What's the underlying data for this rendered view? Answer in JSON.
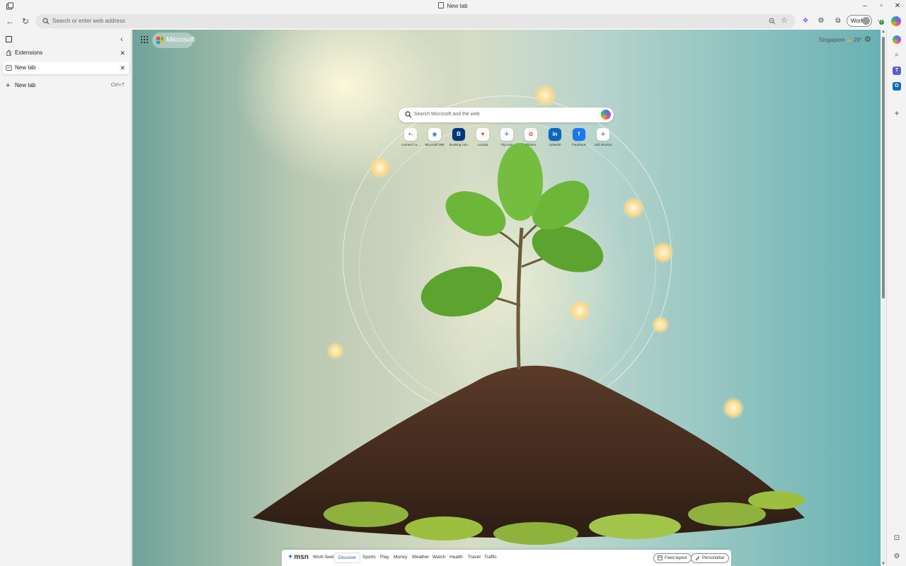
{
  "window": {
    "title": "New tab",
    "controls": [
      "minimize",
      "restore",
      "close"
    ]
  },
  "toolbar": {
    "address_placeholder": "Search or enter web address",
    "profile_label": "Work",
    "notification_badge": "1"
  },
  "sidebar": {
    "tabs": [
      {
        "label": "Extensions",
        "active": false
      },
      {
        "label": "New tab",
        "active": true
      }
    ],
    "new_tab_label": "New tab",
    "new_tab_shortcut": "Ctrl+T"
  },
  "newtab": {
    "brand_label": "Microsoft",
    "weather_location": "Singapore",
    "weather_temp": "29°",
    "search_placeholder": "Search Microsoft and the web",
    "shortcuts": [
      {
        "label": "connect f a...",
        "icon": "connect-icon",
        "glyph": "•-",
        "color": "#555555"
      },
      {
        "label": "Microsoft 365",
        "icon": "microsoft365-icon",
        "glyph": "◉",
        "color": "#3b6fd8"
      },
      {
        "label": "Booking.com",
        "icon": "booking-icon",
        "glyph": "B",
        "color": "#003580"
      },
      {
        "label": "Lazada",
        "icon": "lazada-icon",
        "glyph": "♥",
        "color": "#e8324f"
      },
      {
        "label": "Trip.com",
        "icon": "trip-icon",
        "glyph": "✈",
        "color": "#3264ff"
      },
      {
        "label": "Photos",
        "icon": "photos-icon",
        "glyph": "✿",
        "color": "#ea4335"
      },
      {
        "label": "LinkedIn",
        "icon": "linkedin-icon",
        "glyph": "in",
        "color": "#0a66c2"
      },
      {
        "label": "Facebook",
        "icon": "facebook-icon",
        "glyph": "f",
        "color": "#1877f2"
      },
      {
        "label": "Add shortcut",
        "icon": "add-icon",
        "glyph": "+",
        "color": "#555555"
      }
    ],
    "feed": {
      "logo": "msn",
      "links": [
        {
          "label": "Work feed",
          "active": false
        },
        {
          "label": "Discover",
          "active": true
        },
        {
          "label": "Sports",
          "active": false
        },
        {
          "label": "Play",
          "active": false
        },
        {
          "label": "Money",
          "active": false
        },
        {
          "label": "Weather",
          "active": false
        },
        {
          "label": "Watch",
          "active": false
        },
        {
          "label": "Health",
          "active": false
        },
        {
          "label": "Travel",
          "active": false
        },
        {
          "label": "Traffic",
          "active": false
        }
      ],
      "feed_layout_label": "Feed layout",
      "personalise_label": "Personalise"
    }
  }
}
